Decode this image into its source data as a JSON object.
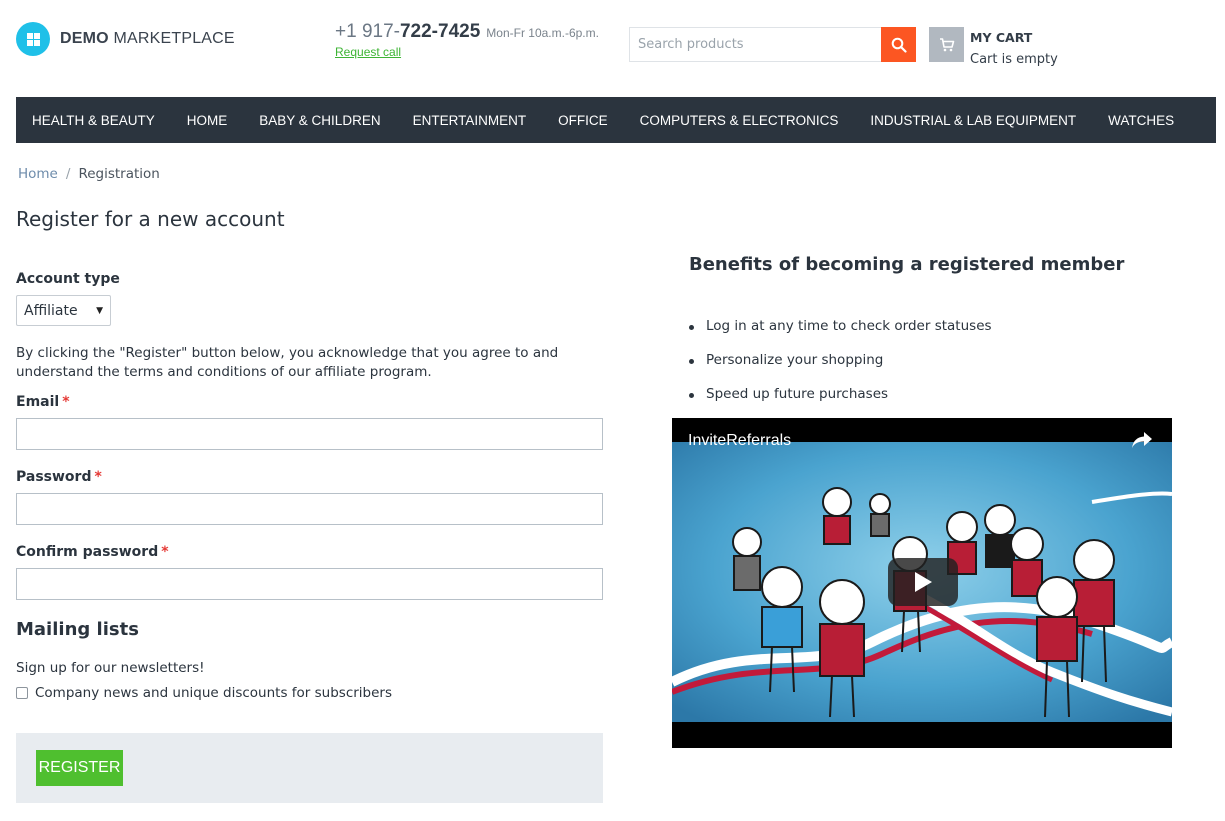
{
  "header": {
    "logo": {
      "brand_bold": "DEMO",
      "brand_rest": "MARKETPLACE",
      "color": "#1fc0e8"
    },
    "phone": {
      "prefix": "+1 917-",
      "number": "722-7425",
      "hours": "Mon-Fr 10a.m.-6p.m.",
      "request_call": "Request call"
    },
    "search": {
      "placeholder": "Search products",
      "button_icon": "search-icon",
      "button_color": "#fc5622"
    },
    "cart": {
      "title": "MY CART",
      "status": "Cart is empty",
      "icon": "cart-icon"
    }
  },
  "nav": {
    "items": [
      "HEALTH & BEAUTY",
      "HOME",
      "BABY & CHILDREN",
      "ENTERTAINMENT",
      "OFFICE",
      "COMPUTERS & ELECTRONICS",
      "INDUSTRIAL & LAB EQUIPMENT",
      "WATCHES"
    ],
    "background": "#2b343e"
  },
  "breadcrumb": {
    "home": "Home",
    "separator": "/",
    "current": "Registration"
  },
  "form": {
    "title": "Register for a new account",
    "account_type": {
      "label": "Account type",
      "selected": "Affiliate"
    },
    "agreement": "By clicking the \"Register\" button below, you acknowledge that you agree to and understand the terms and conditions of our affiliate program.",
    "email": {
      "label": "Email",
      "value": ""
    },
    "password": {
      "label": "Password",
      "value": ""
    },
    "confirm_password": {
      "label": "Confirm password",
      "value": ""
    },
    "required_marker": "*",
    "mailing": {
      "title": "Mailing lists",
      "subtitle": "Sign up for our newsletters!",
      "option": "Company news and unique discounts for subscribers",
      "checked": false
    },
    "submit": {
      "label": "REGISTER",
      "color": "#4fbf2f"
    }
  },
  "benefits": {
    "title": "Benefits of becoming a registered member",
    "items": [
      "Log in at any time to check order statuses",
      "Personalize your shopping",
      "Speed up future purchases"
    ]
  },
  "video": {
    "title": "InviteReferrals",
    "share_icon": "share-icon",
    "play_icon": "play-icon"
  }
}
